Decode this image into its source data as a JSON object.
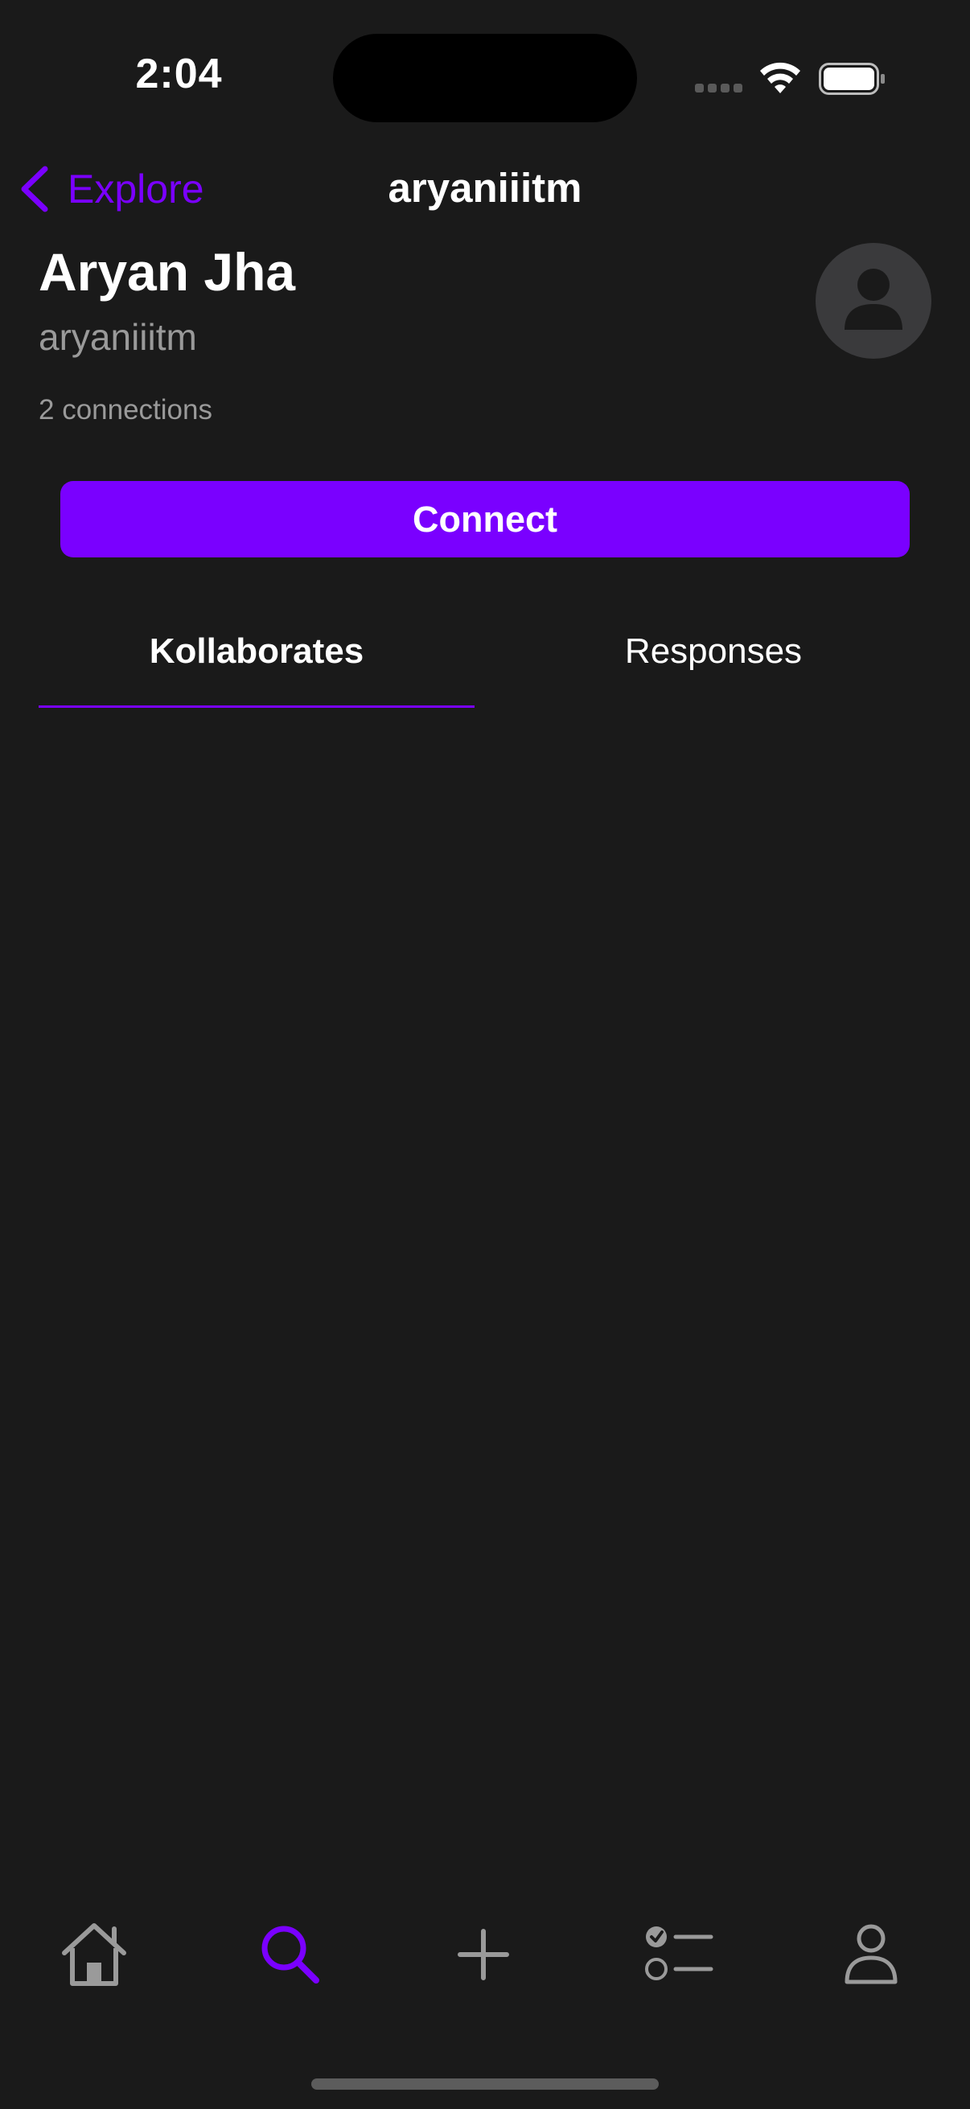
{
  "status_bar": {
    "time": "2:04"
  },
  "nav": {
    "back_label": "Explore",
    "title": "aryaniiitm"
  },
  "profile": {
    "name": "Aryan Jha",
    "username": "aryaniiitm",
    "connections": "2 connections",
    "avatar_icon": "person-icon"
  },
  "actions": {
    "connect_label": "Connect"
  },
  "tabs": [
    {
      "label": "Kollaborates",
      "selected": true
    },
    {
      "label": "Responses",
      "selected": false
    }
  ],
  "tab_bar": {
    "items": [
      {
        "icon": "home-icon",
        "selected": false
      },
      {
        "icon": "search-icon",
        "selected": true
      },
      {
        "icon": "plus-icon",
        "selected": false
      },
      {
        "icon": "checklist-icon",
        "selected": false
      },
      {
        "icon": "profile-icon",
        "selected": false
      }
    ]
  },
  "colors": {
    "accent": "#7a00ff",
    "background": "#1a1a1a",
    "secondary_text": "#9a9a9a",
    "inactive_icon": "#9a9a9a"
  }
}
